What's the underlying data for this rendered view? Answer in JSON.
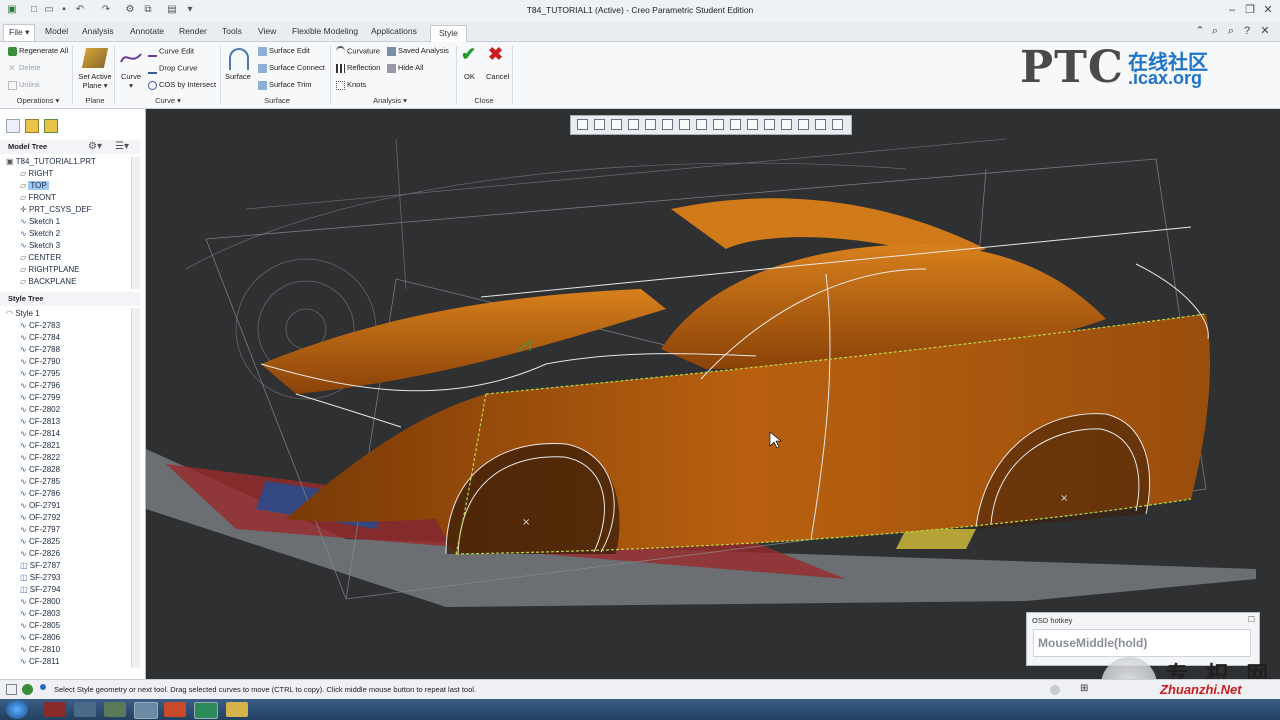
{
  "window": {
    "title": "T84_TUTORIAL1 (Active) - Creo Parametric Student Edition"
  },
  "tabs": [
    {
      "label": "File",
      "suffix": "▾"
    },
    {
      "label": "Model"
    },
    {
      "label": "Analysis"
    },
    {
      "label": "Annotate"
    },
    {
      "label": "Render"
    },
    {
      "label": "Tools"
    },
    {
      "label": "View"
    },
    {
      "label": "Flexible Modeling"
    },
    {
      "label": "Applications"
    },
    {
      "label": "Style"
    }
  ],
  "active_tab": "Style",
  "ribbon": {
    "operations": {
      "regenerate_all": "Regenerate All",
      "delete": "Delete",
      "unlink": "Unlink",
      "group": "Operations"
    },
    "plane": {
      "set_active_plane": "Set Active",
      "set_active_plane2": "Plane",
      "group": "Plane"
    },
    "curve": {
      "curve": "Curve",
      "curve_edit": "Curve Edit",
      "drop_curve": "Drop Curve",
      "cos_by_intersect": "COS by Intersect",
      "group": "Curve"
    },
    "surface": {
      "surface": "Surface",
      "surface_edit": "Surface Edit",
      "surface_connect": "Surface Connect",
      "surface_trim": "Surface Trim",
      "group": "Surface"
    },
    "analysis": {
      "curvature": "Curvature",
      "saved_analysis": "Saved Analysis",
      "reflection": "Reflection",
      "hide_all": "Hide All",
      "knots": "Knots",
      "group": "Analysis"
    },
    "close": {
      "ok": "OK",
      "cancel": "Cancel",
      "group": "Close"
    }
  },
  "logo": {
    "ptc": "PTC",
    "cn": "在线社区",
    "site": ".icax.org"
  },
  "model_tree": {
    "header": "Model Tree",
    "items": [
      {
        "label": "T84_TUTORIAL1.PRT",
        "icon": "part-icon"
      },
      {
        "label": "RIGHT",
        "icon": "datum-plane-icon"
      },
      {
        "label": "TOP",
        "icon": "datum-plane-icon"
      },
      {
        "label": "FRONT",
        "icon": "datum-plane-icon"
      },
      {
        "label": "PRT_CSYS_DEF",
        "icon": "csys-icon"
      },
      {
        "label": "Sketch 1",
        "icon": "sketch-icon"
      },
      {
        "label": "Sketch 2",
        "icon": "sketch-icon"
      },
      {
        "label": "Sketch 3",
        "icon": "sketch-icon"
      },
      {
        "label": "CENTER",
        "icon": "datum-plane-icon"
      },
      {
        "label": "RIGHTPLANE",
        "icon": "datum-plane-icon"
      },
      {
        "label": "BACKPLANE",
        "icon": "datum-plane-icon"
      }
    ],
    "selected": "TOP"
  },
  "style_tree": {
    "header": "Style Tree",
    "root": "Style 1",
    "items": [
      "CF-2783",
      "CF-2784",
      "CF-2788",
      "CF-2790",
      "CF-2795",
      "CF-2796",
      "CF-2799",
      "CF-2802",
      "CF-2813",
      "CF-2814",
      "CF-2821",
      "CF-2822",
      "CF-2828",
      "CF-2785",
      "CF-2786",
      "OF-2791",
      "OF-2792",
      "CF-2797",
      "CF-2825",
      "CF-2826",
      "SF-2787",
      "SF-2793",
      "SF-2794",
      "CF-2800",
      "CF-2803",
      "CF-2805",
      "CF-2806",
      "CF-2810",
      "CF-2811"
    ]
  },
  "osd": {
    "title": "OSD hotkey",
    "value": "MouseMiddle(hold)"
  },
  "status": {
    "message": "Select Style geometry or next tool. Drag selected curves to move (CTRL to copy). Click middle mouse button to repeat last tool."
  },
  "watermark": {
    "cn": "专 枳 网",
    "site": "Zhuanzhi.Net"
  },
  "colors": {
    "surface_orange": "#c8680f",
    "viewport_bg": "#2f3032",
    "accent_green": "#1f9a2a",
    "accent_red": "#c81e1e"
  }
}
